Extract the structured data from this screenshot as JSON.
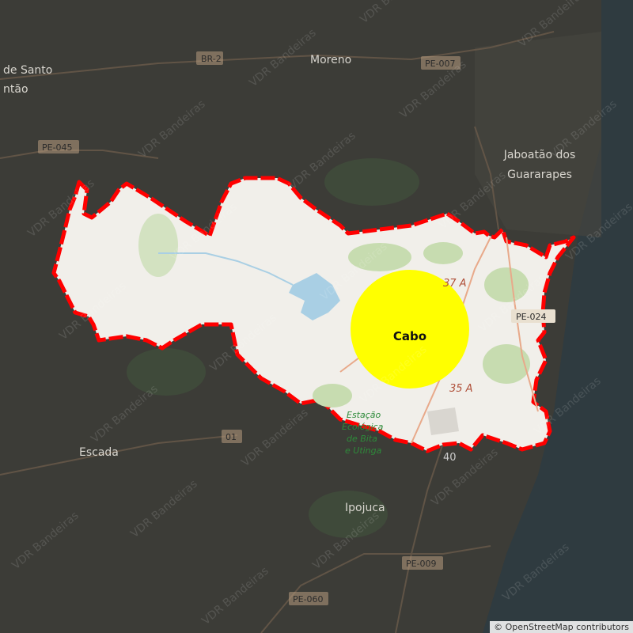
{
  "map": {
    "places": {
      "santo_antao": "de Santo",
      "santo_antao_2": "ntão",
      "moreno": "Moreno",
      "jaboatao_1": "Jaboatão dos",
      "jaboatao_2": "Guararapes",
      "escada": "Escada",
      "ipojuca": "Ipojuca"
    },
    "roads": {
      "br2": "BR-2",
      "pe007": "PE-007",
      "pe045": "PE-045",
      "pe024": "PE-024",
      "r01": "01",
      "pe009": "PE-009",
      "pe060": "PE-060",
      "r37a": "37 A",
      "r35a": "35 A",
      "r40": "40"
    },
    "area_label": [
      "Estação",
      "Ecológica",
      "de Bita",
      "e Utinga"
    ],
    "municipality_label": "Cabo",
    "watermark": "VDR Bandeiras",
    "attribution": "© OpenStreetMap contributors",
    "colors": {
      "boundary": "#ff0000",
      "circle": "#ffff00",
      "sea": "#2f3b40"
    }
  }
}
